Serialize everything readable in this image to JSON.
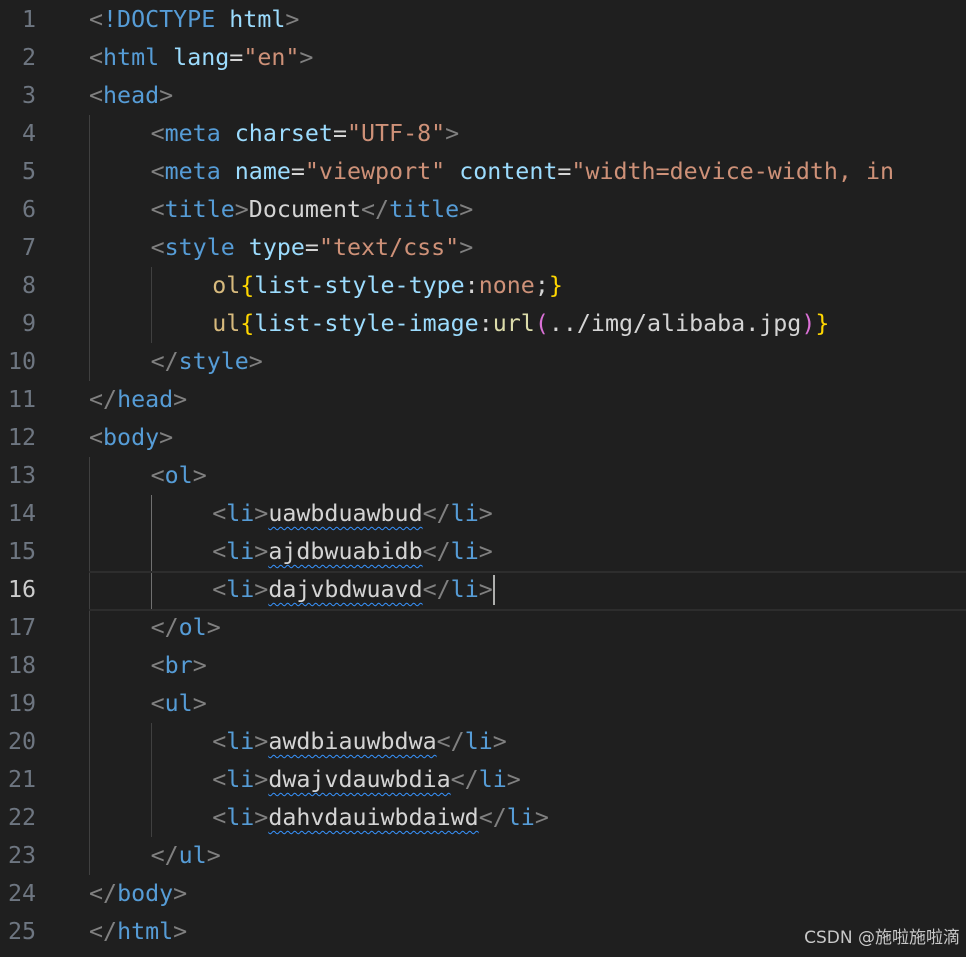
{
  "editor": {
    "language": "html",
    "current_line": 16,
    "colors": {
      "background": "#1f1f1f",
      "line_number": "#6e7681",
      "line_number_active": "#cccccc",
      "tag": "#569cd6",
      "attribute": "#9cdcfe",
      "string": "#ce9178",
      "punctuation": "#808080",
      "selector": "#d7ba7d",
      "squiggle": "#3794ff"
    },
    "lines": [
      {
        "number": "1",
        "indent": 0,
        "tokens": [
          {
            "text": "<",
            "type": "punc"
          },
          {
            "text": "!DOCTYPE",
            "type": "doctype"
          },
          {
            "text": " ",
            "type": "text"
          },
          {
            "text": "html",
            "type": "attr"
          },
          {
            "text": ">",
            "type": "punc"
          }
        ]
      },
      {
        "number": "2",
        "indent": 0,
        "tokens": [
          {
            "text": "<",
            "type": "punc"
          },
          {
            "text": "html",
            "type": "tag"
          },
          {
            "text": " ",
            "type": "text"
          },
          {
            "text": "lang",
            "type": "attr"
          },
          {
            "text": "=",
            "type": "text"
          },
          {
            "text": "\"en\"",
            "type": "str"
          },
          {
            "text": ">",
            "type": "punc"
          }
        ]
      },
      {
        "number": "3",
        "indent": 0,
        "tokens": [
          {
            "text": "<",
            "type": "punc"
          },
          {
            "text": "head",
            "type": "tag"
          },
          {
            "text": ">",
            "type": "punc"
          }
        ]
      },
      {
        "number": "4",
        "indent": 1,
        "tokens": [
          {
            "text": "<",
            "type": "punc"
          },
          {
            "text": "meta",
            "type": "tag"
          },
          {
            "text": " ",
            "type": "text"
          },
          {
            "text": "charset",
            "type": "attr"
          },
          {
            "text": "=",
            "type": "text"
          },
          {
            "text": "\"UTF-8\"",
            "type": "str"
          },
          {
            "text": ">",
            "type": "punc"
          }
        ]
      },
      {
        "number": "5",
        "indent": 1,
        "tokens": [
          {
            "text": "<",
            "type": "punc"
          },
          {
            "text": "meta",
            "type": "tag"
          },
          {
            "text": " ",
            "type": "text"
          },
          {
            "text": "name",
            "type": "attr"
          },
          {
            "text": "=",
            "type": "text"
          },
          {
            "text": "\"viewport\"",
            "type": "str"
          },
          {
            "text": " ",
            "type": "text"
          },
          {
            "text": "content",
            "type": "attr"
          },
          {
            "text": "=",
            "type": "text"
          },
          {
            "text": "\"width=device-width, in",
            "type": "str"
          }
        ]
      },
      {
        "number": "6",
        "indent": 1,
        "tokens": [
          {
            "text": "<",
            "type": "punc"
          },
          {
            "text": "title",
            "type": "tag"
          },
          {
            "text": ">",
            "type": "punc"
          },
          {
            "text": "Document",
            "type": "text"
          },
          {
            "text": "</",
            "type": "punc"
          },
          {
            "text": "title",
            "type": "tag"
          },
          {
            "text": ">",
            "type": "punc"
          }
        ]
      },
      {
        "number": "7",
        "indent": 1,
        "tokens": [
          {
            "text": "<",
            "type": "punc"
          },
          {
            "text": "style",
            "type": "tag"
          },
          {
            "text": " ",
            "type": "text"
          },
          {
            "text": "type",
            "type": "attr"
          },
          {
            "text": "=",
            "type": "text"
          },
          {
            "text": "\"text/css\"",
            "type": "str"
          },
          {
            "text": ">",
            "type": "punc"
          }
        ]
      },
      {
        "number": "8",
        "indent": 2,
        "tokens": [
          {
            "text": "ol",
            "type": "sel"
          },
          {
            "text": "{",
            "type": "brace1"
          },
          {
            "text": "list-style-type",
            "type": "prop"
          },
          {
            "text": ":",
            "type": "text"
          },
          {
            "text": "none",
            "type": "val"
          },
          {
            "text": ";",
            "type": "text"
          },
          {
            "text": "}",
            "type": "brace1"
          }
        ]
      },
      {
        "number": "9",
        "indent": 2,
        "tokens": [
          {
            "text": "ul",
            "type": "sel"
          },
          {
            "text": "{",
            "type": "brace1"
          },
          {
            "text": "list-style-image",
            "type": "prop"
          },
          {
            "text": ":",
            "type": "text"
          },
          {
            "text": "url",
            "type": "func"
          },
          {
            "text": "(",
            "type": "brace2"
          },
          {
            "text": "../img/alibaba.jpg",
            "type": "text"
          },
          {
            "text": ")",
            "type": "brace2"
          },
          {
            "text": "}",
            "type": "brace1"
          }
        ]
      },
      {
        "number": "10",
        "indent": 1,
        "tokens": [
          {
            "text": "</",
            "type": "punc"
          },
          {
            "text": "style",
            "type": "tag"
          },
          {
            "text": ">",
            "type": "punc"
          }
        ]
      },
      {
        "number": "11",
        "indent": 0,
        "tokens": [
          {
            "text": "</",
            "type": "punc"
          },
          {
            "text": "head",
            "type": "tag"
          },
          {
            "text": ">",
            "type": "punc"
          }
        ]
      },
      {
        "number": "12",
        "indent": 0,
        "tokens": [
          {
            "text": "<",
            "type": "punc"
          },
          {
            "text": "body",
            "type": "tag"
          },
          {
            "text": ">",
            "type": "punc"
          }
        ]
      },
      {
        "number": "13",
        "indent": 1,
        "tokens": [
          {
            "text": "<",
            "type": "punc"
          },
          {
            "text": "ol",
            "type": "tag"
          },
          {
            "text": ">",
            "type": "punc"
          }
        ]
      },
      {
        "number": "14",
        "indent": 2,
        "tokens": [
          {
            "text": "<",
            "type": "punc"
          },
          {
            "text": "li",
            "type": "tag"
          },
          {
            "text": ">",
            "type": "punc"
          },
          {
            "text": "uawbduawbud",
            "type": "squig"
          },
          {
            "text": "</",
            "type": "punc"
          },
          {
            "text": "li",
            "type": "tag"
          },
          {
            "text": ">",
            "type": "punc"
          }
        ]
      },
      {
        "number": "15",
        "indent": 2,
        "tokens": [
          {
            "text": "<",
            "type": "punc"
          },
          {
            "text": "li",
            "type": "tag"
          },
          {
            "text": ">",
            "type": "punc"
          },
          {
            "text": "ajdbwuabidb",
            "type": "squig"
          },
          {
            "text": "</",
            "type": "punc"
          },
          {
            "text": "li",
            "type": "tag"
          },
          {
            "text": ">",
            "type": "punc"
          }
        ]
      },
      {
        "number": "16",
        "indent": 2,
        "tokens": [
          {
            "text": "<",
            "type": "punc"
          },
          {
            "text": "li",
            "type": "tag"
          },
          {
            "text": ">",
            "type": "punc"
          },
          {
            "text": "dajvbdwuavd",
            "type": "squig"
          },
          {
            "text": "</",
            "type": "punc"
          },
          {
            "text": "li",
            "type": "tag"
          },
          {
            "text": ">",
            "type": "punc"
          }
        ]
      },
      {
        "number": "17",
        "indent": 1,
        "tokens": [
          {
            "text": "</",
            "type": "punc"
          },
          {
            "text": "ol",
            "type": "tag"
          },
          {
            "text": ">",
            "type": "punc"
          }
        ]
      },
      {
        "number": "18",
        "indent": 1,
        "tokens": [
          {
            "text": "<",
            "type": "punc"
          },
          {
            "text": "br",
            "type": "tag"
          },
          {
            "text": ">",
            "type": "punc"
          }
        ]
      },
      {
        "number": "19",
        "indent": 1,
        "tokens": [
          {
            "text": "<",
            "type": "punc"
          },
          {
            "text": "ul",
            "type": "tag"
          },
          {
            "text": ">",
            "type": "punc"
          }
        ]
      },
      {
        "number": "20",
        "indent": 2,
        "tokens": [
          {
            "text": "<",
            "type": "punc"
          },
          {
            "text": "li",
            "type": "tag"
          },
          {
            "text": ">",
            "type": "punc"
          },
          {
            "text": "awdbiauwbdwa",
            "type": "squig"
          },
          {
            "text": "</",
            "type": "punc"
          },
          {
            "text": "li",
            "type": "tag"
          },
          {
            "text": ">",
            "type": "punc"
          }
        ]
      },
      {
        "number": "21",
        "indent": 2,
        "tokens": [
          {
            "text": "<",
            "type": "punc"
          },
          {
            "text": "li",
            "type": "tag"
          },
          {
            "text": ">",
            "type": "punc"
          },
          {
            "text": "dwajvdauwbdia",
            "type": "squig"
          },
          {
            "text": "</",
            "type": "punc"
          },
          {
            "text": "li",
            "type": "tag"
          },
          {
            "text": ">",
            "type": "punc"
          }
        ]
      },
      {
        "number": "22",
        "indent": 2,
        "tokens": [
          {
            "text": "<",
            "type": "punc"
          },
          {
            "text": "li",
            "type": "tag"
          },
          {
            "text": ">",
            "type": "punc"
          },
          {
            "text": "dahvdauiwbdaiwd",
            "type": "squig"
          },
          {
            "text": "</",
            "type": "punc"
          },
          {
            "text": "li",
            "type": "tag"
          },
          {
            "text": ">",
            "type": "punc"
          }
        ]
      },
      {
        "number": "23",
        "indent": 1,
        "tokens": [
          {
            "text": "</",
            "type": "punc"
          },
          {
            "text": "ul",
            "type": "tag"
          },
          {
            "text": ">",
            "type": "punc"
          }
        ]
      },
      {
        "number": "24",
        "indent": 0,
        "tokens": [
          {
            "text": "</",
            "type": "punc"
          },
          {
            "text": "body",
            "type": "tag"
          },
          {
            "text": ">",
            "type": "punc"
          }
        ]
      },
      {
        "number": "25",
        "indent": 0,
        "tokens": [
          {
            "text": "</",
            "type": "punc"
          },
          {
            "text": "html",
            "type": "tag"
          },
          {
            "text": ">",
            "type": "punc"
          }
        ]
      }
    ]
  },
  "watermark": {
    "text": "CSDN @施啦施啦滴"
  }
}
